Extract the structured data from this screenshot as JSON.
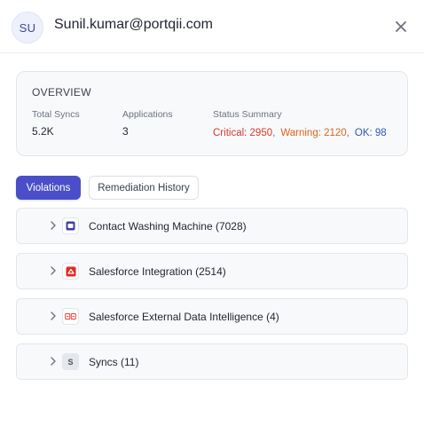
{
  "header": {
    "avatar_initials": "SU",
    "email": "Sunil.kumar@portqii.com",
    "close_icon": "close-icon"
  },
  "overview": {
    "title": "OVERVIEW",
    "total_syncs": {
      "label": "Total Syncs",
      "value": "5.2K"
    },
    "applications": {
      "label": "Applications",
      "value": "3"
    },
    "status_summary": {
      "label": "Status Summary",
      "critical": "Critical: 2950",
      "warning": "Warning: 2120",
      "ok": "OK: 98",
      "separator": ",",
      "colors": {
        "critical": "#d43a2a",
        "warning": "#d9661e",
        "ok": "#2f55b8"
      }
    }
  },
  "tabs": [
    {
      "label": "Violations",
      "active": true
    },
    {
      "label": "Remediation History",
      "active": false
    }
  ],
  "accent_color": "#4a4fc9",
  "rows": [
    {
      "label": "Contact Washing Machine (7028)",
      "icon": "washing-machine-icon"
    },
    {
      "label": "Salesforce Integration (2514)",
      "icon": "salesforce-integration-icon"
    },
    {
      "label": "Salesforce External Data Intelligence (4)",
      "icon": "data-intelligence-icon"
    },
    {
      "label": "Syncs (11)",
      "icon": "syncs-icon",
      "icon_text": "S"
    }
  ]
}
